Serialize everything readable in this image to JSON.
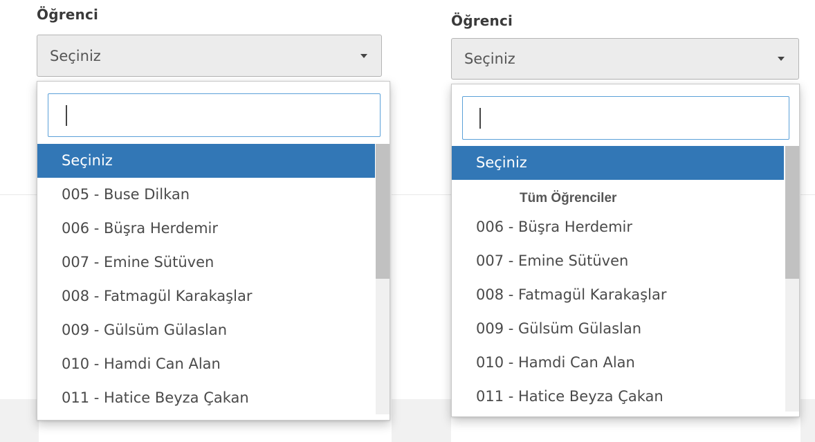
{
  "left": {
    "label": "Öğrenci",
    "select_value": "Seçiniz",
    "search_value": "",
    "items": [
      {
        "text": "Seçiniz",
        "selected": true
      },
      {
        "text": "005 - Buse Dilkan",
        "selected": false
      },
      {
        "text": "006 - Büşra Herdemir",
        "selected": false
      },
      {
        "text": "007 - Emine Sütüven",
        "selected": false
      },
      {
        "text": "008 - Fatmagül Karakaşlar",
        "selected": false
      },
      {
        "text": "009 - Gülsüm Gülaslan",
        "selected": false
      },
      {
        "text": "010 - Hamdi Can Alan",
        "selected": false
      },
      {
        "text": "011 - Hatice Beyza Çakan",
        "selected": false
      }
    ]
  },
  "right": {
    "label": "Öğrenci",
    "select_value": "Seçiniz",
    "search_value": "",
    "selected_item": "Seçiniz",
    "group_label": "Tüm Öğrenciler",
    "items": [
      {
        "text": "006 - Büşra Herdemir"
      },
      {
        "text": "007 - Emine Sütüven"
      },
      {
        "text": "008 - Fatmagül Karakaşlar"
      },
      {
        "text": "009 - Gülsüm Gülaslan"
      },
      {
        "text": "010 - Hamdi Can Alan"
      },
      {
        "text": "011 - Hatice Beyza Çakan"
      }
    ]
  },
  "colors": {
    "selected_bg": "#3277b6",
    "focus_border": "#5aa0d8",
    "select_bg": "#ececec"
  }
}
